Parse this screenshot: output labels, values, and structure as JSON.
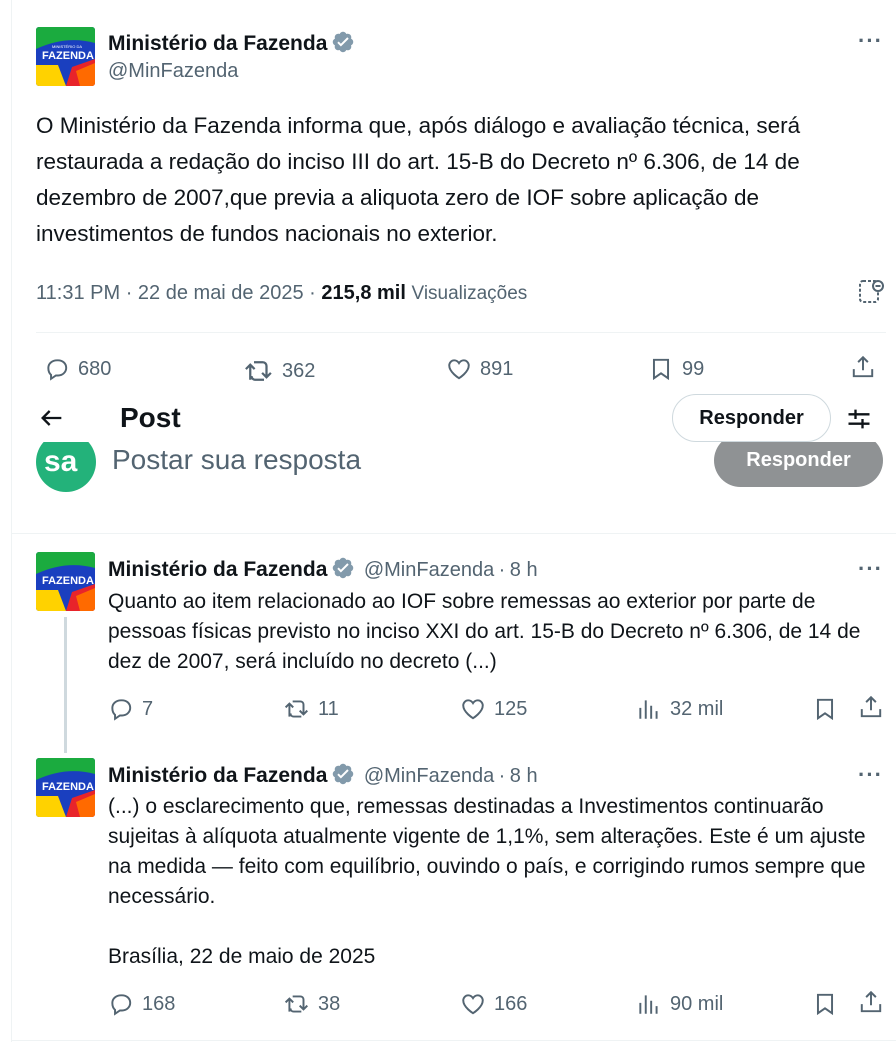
{
  "main_tweet": {
    "author_name": "Ministério da Fazenda",
    "handle": "@MinFazenda",
    "text": "O Ministério da Fazenda informa que, após diálogo e avaliação técnica, será restaurada a redação do inciso III do art. 15-B do Decreto nº 6.306, de 14 de dezembro de 2007,que previa a aliquota zero de IOF sobre aplicação de investimentos de fundos nacionais no exterior.",
    "time": "11:31 PM",
    "date": "22 de mai de 2025",
    "views_count": "215,8 mil",
    "views_label": "Visualizações",
    "replies": "680",
    "retweets": "362",
    "likes": "891",
    "bookmarks": "99"
  },
  "header": {
    "title": "Post",
    "respond_button": "Responder"
  },
  "composer": {
    "placeholder": "Postar sua resposta",
    "submit_label": "Responder"
  },
  "avatar_logo": {
    "small_text": "MINISTÉRIO DA",
    "big_text": "FAZENDA"
  },
  "replies": [
    {
      "author_name": "Ministério da Fazenda",
      "handle": "@MinFazenda",
      "time_ago": "8 h",
      "text": "Quanto ao item relacionado ao IOF sobre remessas ao exterior por parte de pessoas físicas previsto no inciso XXI do art. 15-B do Decreto nº 6.306, de 14 de dez de 2007, será incluído no decreto (...)",
      "replies": "7",
      "retweets": "11",
      "likes": "125",
      "views": "32 mil"
    },
    {
      "author_name": "Ministério da Fazenda",
      "handle": "@MinFazenda",
      "time_ago": "8 h",
      "text": "(...) o esclarecimento que, remessas destinadas a Investimentos continuarão sujeitas à alíquota atualmente vigente de 1,1%, sem alterações. Este é um ajuste na medida — feito com equilíbrio, ouvindo o país, e corrigindo rumos sempre que necessário.\n\nBrasília, 22 de maio de 2025",
      "replies": "168",
      "retweets": "38",
      "likes": "166",
      "views": "90 mil"
    }
  ],
  "colors": {
    "verified": "#829aab",
    "text_primary": "#0f1419",
    "text_secondary": "#536471",
    "logo_blue": "#1a3fbf",
    "logo_green": "#1bab3f",
    "logo_yellow": "#ffd200",
    "logo_red": "#e8242a"
  },
  "icons": [
    "verified-badge-icon",
    "more-icon",
    "reply-icon",
    "retweet-icon",
    "like-icon",
    "bookmark-icon",
    "share-icon",
    "views-icon",
    "back-arrow-icon",
    "filter-icon",
    "grok-icon"
  ]
}
